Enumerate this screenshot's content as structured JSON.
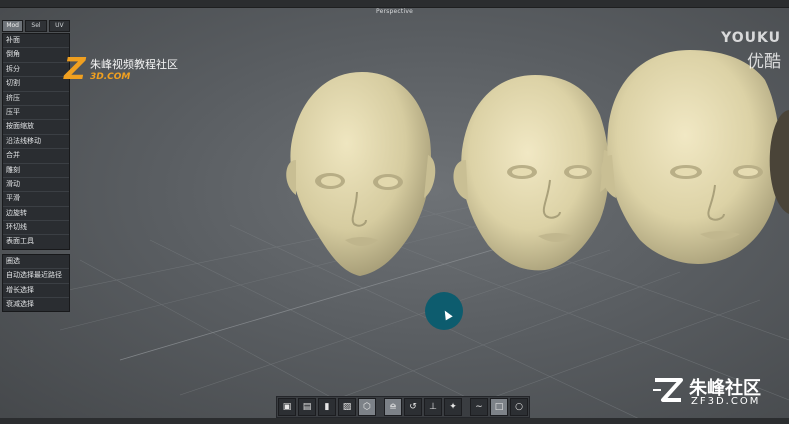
{
  "viewport": {
    "title": "Perspective"
  },
  "panel": {
    "tabs": [
      {
        "label": "Mod",
        "active": true
      },
      {
        "label": "Sel",
        "active": false
      },
      {
        "label": "UV",
        "active": false
      }
    ],
    "tools": [
      "补面",
      "倒角",
      "拆分",
      "切割",
      "挤压",
      "压平",
      "按面缩放",
      "沿法线移动",
      "合并",
      "雕刻",
      "滑动",
      "平滑",
      "边旋转",
      "环切线",
      "表面工具"
    ],
    "selection": [
      "圈选",
      "自动选择最近路径",
      "增长选择",
      "衰减选择"
    ]
  },
  "watermarks": {
    "zf_left": {
      "text": "朱峰视频教程社区",
      "sub": "3D.COM"
    },
    "youku": {
      "en": "YOUKU",
      "cn": "优酷"
    },
    "zf_logo": {
      "name": "朱峰社区",
      "domain": "ZF3D.COM"
    }
  },
  "toolbar": {
    "icons": [
      "view-persp-icon",
      "view-top-icon",
      "view-front-icon",
      "view-side-icon",
      "wireframe-icon",
      "move-gizmo-icon",
      "rotate-gizmo-icon",
      "scale-gizmo-icon",
      "transform-gizmo-icon",
      "select-lasso-icon",
      "select-box-icon",
      "select-paint-icon"
    ],
    "selected": [
      "wireframe-icon",
      "select-box-icon"
    ]
  },
  "colors": {
    "panel": "#2a2d31",
    "skin": "#d9cfa3",
    "cursor_spot": "#0d5c6e",
    "accent": "#f0a020"
  }
}
